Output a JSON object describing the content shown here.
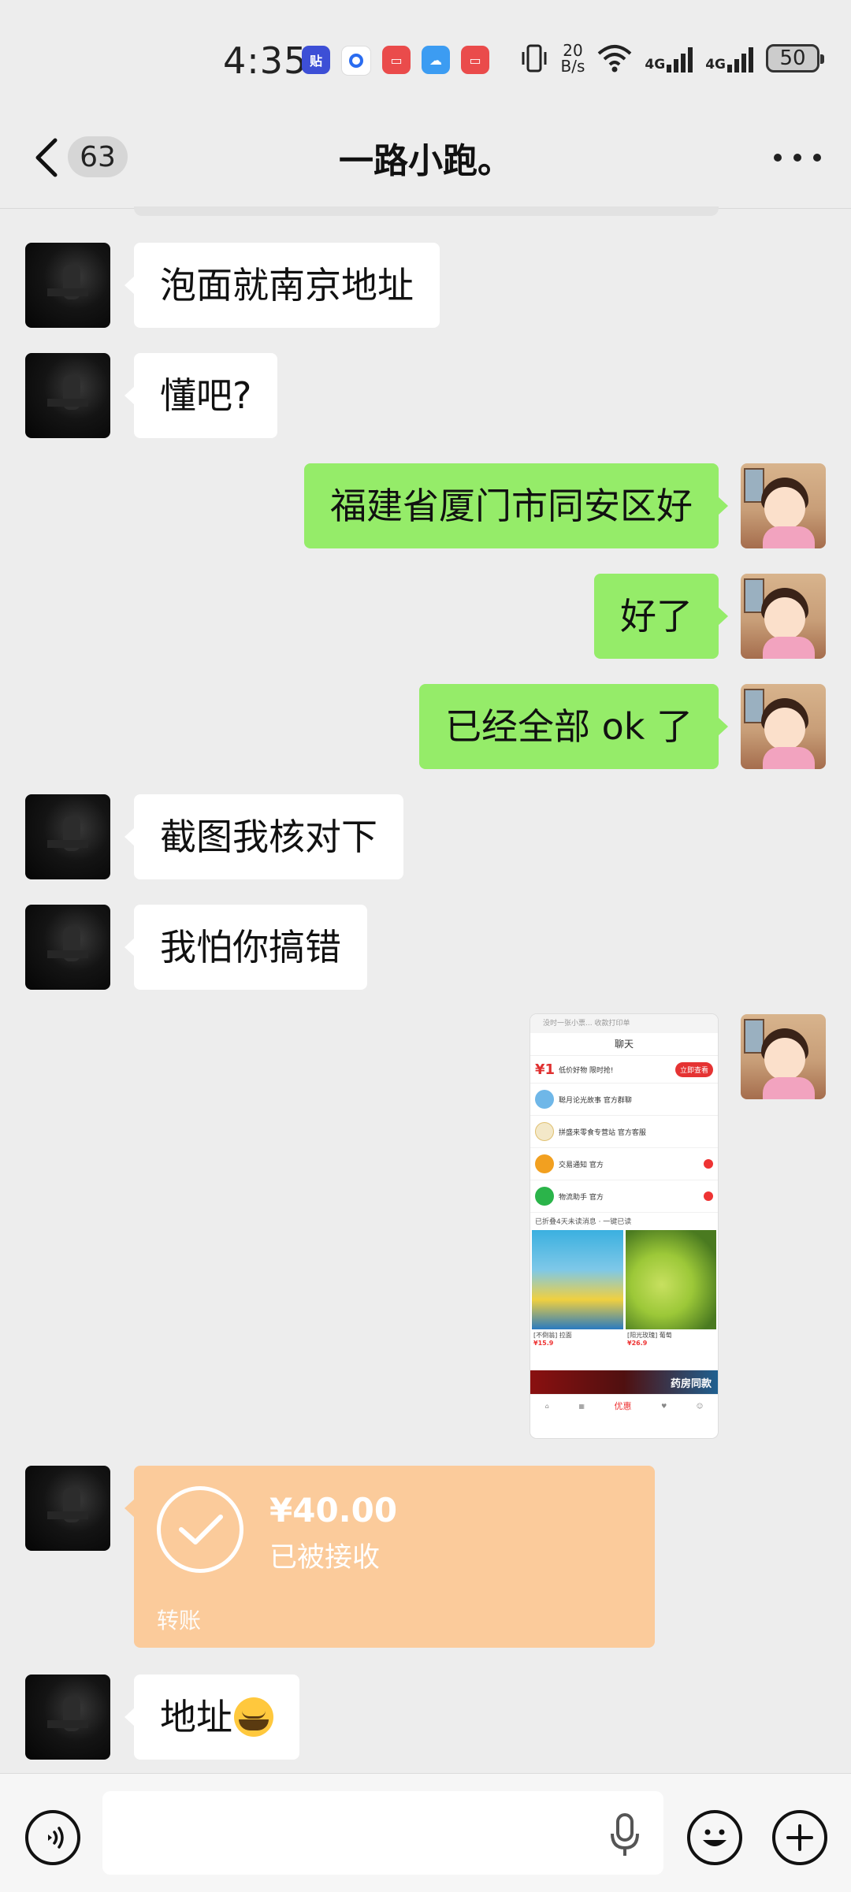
{
  "status_bar": {
    "time": "4:35",
    "speed_value": "20",
    "speed_unit": "B/s",
    "network_1": "4G",
    "network_2": "4G",
    "battery": "50",
    "app_icons": [
      "tieba-icon",
      "assistant-icon",
      "huawei-store-icon",
      "weather-icon",
      "huawei-store-icon"
    ]
  },
  "header": {
    "unread_count": "63",
    "title": "一路小跑。"
  },
  "messages": [
    {
      "side": "left",
      "text": "泡面就南京地址"
    },
    {
      "side": "left",
      "text": "懂吧?"
    },
    {
      "side": "right",
      "text": "福建省厦门市同安区好"
    },
    {
      "side": "right",
      "text": "好了"
    },
    {
      "side": "right",
      "text": "已经全部 ok 了"
    },
    {
      "side": "left",
      "text": "截图我核对下"
    },
    {
      "side": "left",
      "text": "我怕你搞错"
    }
  ],
  "image_message": {
    "top_text": "没时一张小票... 收款打印单",
    "title": "聊天",
    "banner_mark": "¥1",
    "banner_text": "低价好物 限时抢!",
    "banner_button": "立即查看",
    "rows": [
      "聪月论光故事 官方群聊",
      "拼盛来零食专营站 官方客服",
      "交易通知 官方",
      "物流助手 官方"
    ],
    "fold_text": "已折叠4天未读消息 · 一键已读",
    "product_1": "[不倒翁] 拉面",
    "product_1_price": "¥15.9",
    "product_2": "[阳光玫瑰] 葡萄",
    "product_2_price": "¥26.9",
    "strip_text": "药房同款",
    "tab_active": "优惠"
  },
  "transfer": {
    "amount": "¥40.00",
    "status": "已被接收",
    "label": "转账"
  },
  "last_message": {
    "text": "地址",
    "emoji": "laughing-crying-emoji"
  },
  "input_bar": {
    "placeholder": ""
  },
  "colors": {
    "background": "#ededed",
    "bubble_left": "#ffffff",
    "bubble_right": "#95ec69",
    "transfer": "#fbcb9b"
  }
}
